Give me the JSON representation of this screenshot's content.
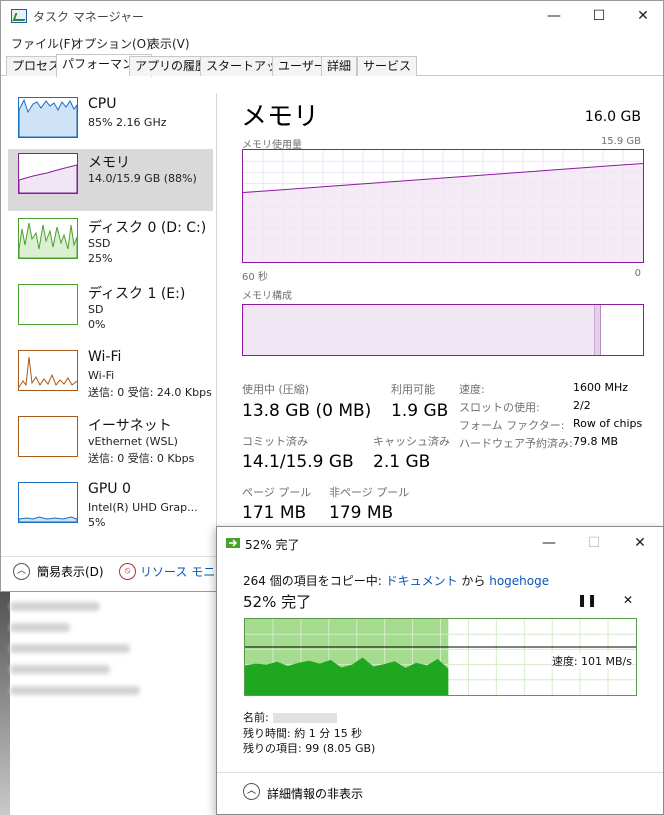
{
  "window": {
    "title": "タスク マネージャー",
    "minimize": "—",
    "maximize": "☐",
    "close": "✕"
  },
  "menu": [
    "ファイル(F)",
    "オプション(O)",
    "表示(V)"
  ],
  "tabs": [
    "プロセス",
    "パフォーマンス",
    "アプリの履歴",
    "スタートアップ",
    "ユーザー",
    "詳細",
    "サービス"
  ],
  "active_tab": "パフォーマンス",
  "sidebar": [
    {
      "name": "CPU",
      "sub1": "85%  2.16 GHz",
      "sub2": "",
      "color": "#1a6ec0",
      "icon": "cpu-graph"
    },
    {
      "name": "メモリ",
      "sub1": "14.0/15.9 GB (88%)",
      "sub2": "",
      "color": "#8b1a9e",
      "icon": "memory-graph"
    },
    {
      "name": "ディスク 0 (D: C:)",
      "sub1": "SSD",
      "sub2": "25%",
      "color": "#4aa02c",
      "icon": "disk-graph"
    },
    {
      "name": "ディスク 1 (E:)",
      "sub1": "SD",
      "sub2": "0%",
      "color": "#4aa02c",
      "icon": "disk-graph"
    },
    {
      "name": "Wi-Fi",
      "sub1": "Wi-Fi",
      "sub2": "送信: 0  受信: 24.0 Kbps",
      "color": "#a7591a",
      "icon": "network-graph"
    },
    {
      "name": "イーサネット",
      "sub1": "vEthernet (WSL)",
      "sub2": "送信: 0  受信: 0 Kbps",
      "color": "#a7591a",
      "icon": "network-graph"
    },
    {
      "name": "GPU 0",
      "sub1": "Intel(R) UHD Grap...",
      "sub2": "5%",
      "color": "#1a6ec0",
      "icon": "gpu-graph"
    }
  ],
  "memory": {
    "title": "メモリ",
    "capacity": "16.0 GB",
    "usage_label": "メモリ使用量",
    "usage_max": "15.9 GB",
    "time_left": "60 秒",
    "time_right": "0",
    "composition_label": "メモリ構成",
    "usage_series": [
      0.62,
      0.64,
      0.66,
      0.68,
      0.7,
      0.72,
      0.74,
      0.76,
      0.78,
      0.8,
      0.82,
      0.84,
      0.86,
      0.88
    ],
    "composition_in_use_fraction": 0.88,
    "stats": {
      "in_use_label": "使用中 (圧縮)",
      "in_use_value": "13.8 GB (0 MB)",
      "available_label": "利用可能",
      "available_value": "1.9 GB",
      "committed_label": "コミット済み",
      "committed_value": "14.1/15.9 GB",
      "cached_label": "キャッシュ済み",
      "cached_value": "2.1 GB",
      "paged_label": "ページ プール",
      "paged_value": "171 MB",
      "nonpaged_label": "非ページ プール",
      "nonpaged_value": "179 MB"
    },
    "details": [
      {
        "label": "速度:",
        "value": "1600 MHz"
      },
      {
        "label": "スロットの使用:",
        "value": "2/2"
      },
      {
        "label": "フォーム ファクター:",
        "value": "Row of chips"
      },
      {
        "label": "ハードウェア予約済み:",
        "value": "79.8 MB"
      }
    ]
  },
  "footer": {
    "simple_view": "簡易表示(D)",
    "resource_monitor": "リソース モニターを"
  },
  "copy_dialog": {
    "title": "52% 完了",
    "line_prefix": "264 個の項目をコピー中: ",
    "from_label": "ドキュメント",
    "middle": " から ",
    "to_label": "hogehoge",
    "progress_text": "52% 完了",
    "progress": 0.52,
    "pause_icon": "❚❚",
    "cancel_icon": "✕",
    "speed": "速度: 101 MB/s",
    "name_label": "名前:",
    "remaining_time": "残り時間: 約 1 分 15 秒",
    "remaining_items": "残りの項目: 99 (8.05 GB)",
    "toggle_details": "詳細情報の非表示",
    "speed_series": [
      62,
      66,
      64,
      70,
      61,
      68,
      72,
      66,
      74,
      58,
      64,
      79,
      60,
      65,
      71,
      57,
      68,
      62,
      76,
      55
    ],
    "minimize": "—",
    "maximize": "☐",
    "close": "✕"
  }
}
